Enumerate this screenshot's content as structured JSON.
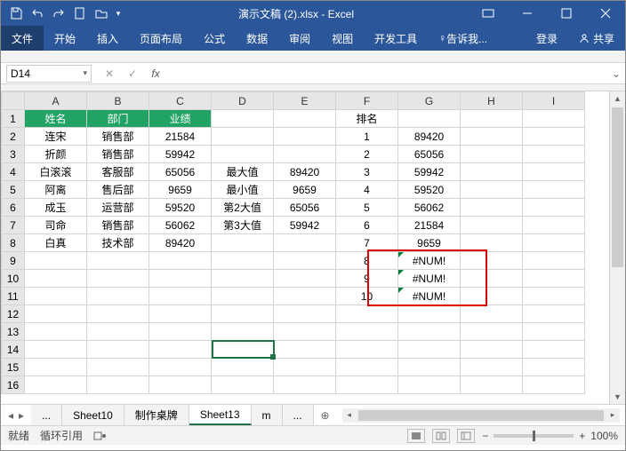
{
  "app": {
    "title": "演示文稿 (2).xlsx - Excel"
  },
  "qat": {
    "save": "save",
    "undo": "undo",
    "redo": "redo",
    "new": "new",
    "open": "open"
  },
  "tabs": {
    "file": "文件",
    "home": "开始",
    "insert": "插入",
    "layout": "页面布局",
    "formulas": "公式",
    "data": "数据",
    "review": "审阅",
    "view": "视图",
    "dev": "开发工具",
    "tell": "告诉我...",
    "login": "登录",
    "share": "共享"
  },
  "namebox": {
    "ref": "D14"
  },
  "fx": {
    "label": "fx"
  },
  "columns": [
    "A",
    "B",
    "C",
    "D",
    "E",
    "F",
    "G",
    "H",
    "I"
  ],
  "rows": [
    "1",
    "2",
    "3",
    "4",
    "5",
    "6",
    "7",
    "8",
    "9",
    "10",
    "11",
    "12",
    "13",
    "14",
    "15",
    "16"
  ],
  "headers": {
    "name": "姓名",
    "dept": "部门",
    "perf": "业绩",
    "rank": "排名"
  },
  "people": [
    {
      "name": "连宋",
      "dept": "销售部",
      "perf": "21584"
    },
    {
      "name": "折颜",
      "dept": "销售部",
      "perf": "59942"
    },
    {
      "name": "白滚滚",
      "dept": "客服部",
      "perf": "65056"
    },
    {
      "name": "阿离",
      "dept": "售后部",
      "perf": "9659"
    },
    {
      "name": "成玉",
      "dept": "运营部",
      "perf": "59520"
    },
    {
      "name": "司命",
      "dept": "销售部",
      "perf": "56062"
    },
    {
      "name": "白真",
      "dept": "技术部",
      "perf": "89420"
    }
  ],
  "stats": [
    {
      "label": "最大值",
      "val": "89420"
    },
    {
      "label": "最小值",
      "val": "9659"
    },
    {
      "label": "第2大值",
      "val": "65056"
    },
    {
      "label": "第3大值",
      "val": "59942"
    }
  ],
  "rank": [
    {
      "n": "1",
      "v": "89420"
    },
    {
      "n": "2",
      "v": "65056"
    },
    {
      "n": "3",
      "v": "59942"
    },
    {
      "n": "4",
      "v": "59520"
    },
    {
      "n": "5",
      "v": "56062"
    },
    {
      "n": "6",
      "v": "21584"
    },
    {
      "n": "7",
      "v": "9659"
    },
    {
      "n": "8",
      "v": "#NUM!"
    },
    {
      "n": "9",
      "v": "#NUM!"
    },
    {
      "n": "10",
      "v": "#NUM!"
    }
  ],
  "sheets": {
    "dots": "...",
    "s1": "Sheet10",
    "s2": "制作桌牌",
    "s3": "Sheet13",
    "s4": "m",
    "dots2": "..."
  },
  "status": {
    "ready": "就绪",
    "circ": "循环引用",
    "zoom": "100%",
    "minus": "−",
    "plus": "+"
  }
}
